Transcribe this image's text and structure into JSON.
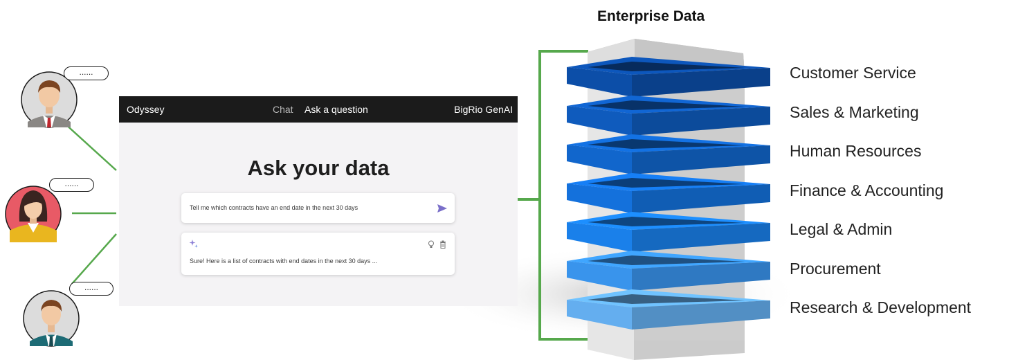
{
  "diagram_title": "Enterprise Data",
  "app": {
    "brand": "Odyssey",
    "nav_chat": "Chat",
    "nav_ask": "Ask a question",
    "product": "BigRio GenAI",
    "heading": "Ask your data",
    "query": "Tell me which contracts have an end date in the next 30 days",
    "answer": "Sure! Here is a list of contracts with end dates in the next 30 days ...",
    "send_icon": "send-icon",
    "answer_icon": "sparkle-icon",
    "feedback_icons": [
      "lightbulb-icon",
      "trash-icon"
    ]
  },
  "users": [
    {
      "bubble": "......",
      "avatar": "male-user-avatar"
    },
    {
      "bubble": "......",
      "avatar": "female-user-avatar"
    },
    {
      "bubble": "......",
      "avatar": "male-user-avatar"
    }
  ],
  "departments": [
    {
      "label": "Customer Service",
      "color": "#0c4ea8"
    },
    {
      "label": "Sales & Marketing",
      "color": "#0f5bbd"
    },
    {
      "label": "Human Resources",
      "color": "#1166cc"
    },
    {
      "label": "Finance & Accounting",
      "color": "#1471dc"
    },
    {
      "label": "Legal & Admin",
      "color": "#1a80ea"
    },
    {
      "label": "Procurement",
      "color": "#3994ec"
    },
    {
      "label": "Research & Development",
      "color": "#64aeef"
    }
  ],
  "colors": {
    "connector": "#56a84c",
    "server_light": "#e4e4e4",
    "server_dark": "#c8c8c8",
    "topbar": "#1b1b1b",
    "app_background": "#f4f3f5"
  }
}
